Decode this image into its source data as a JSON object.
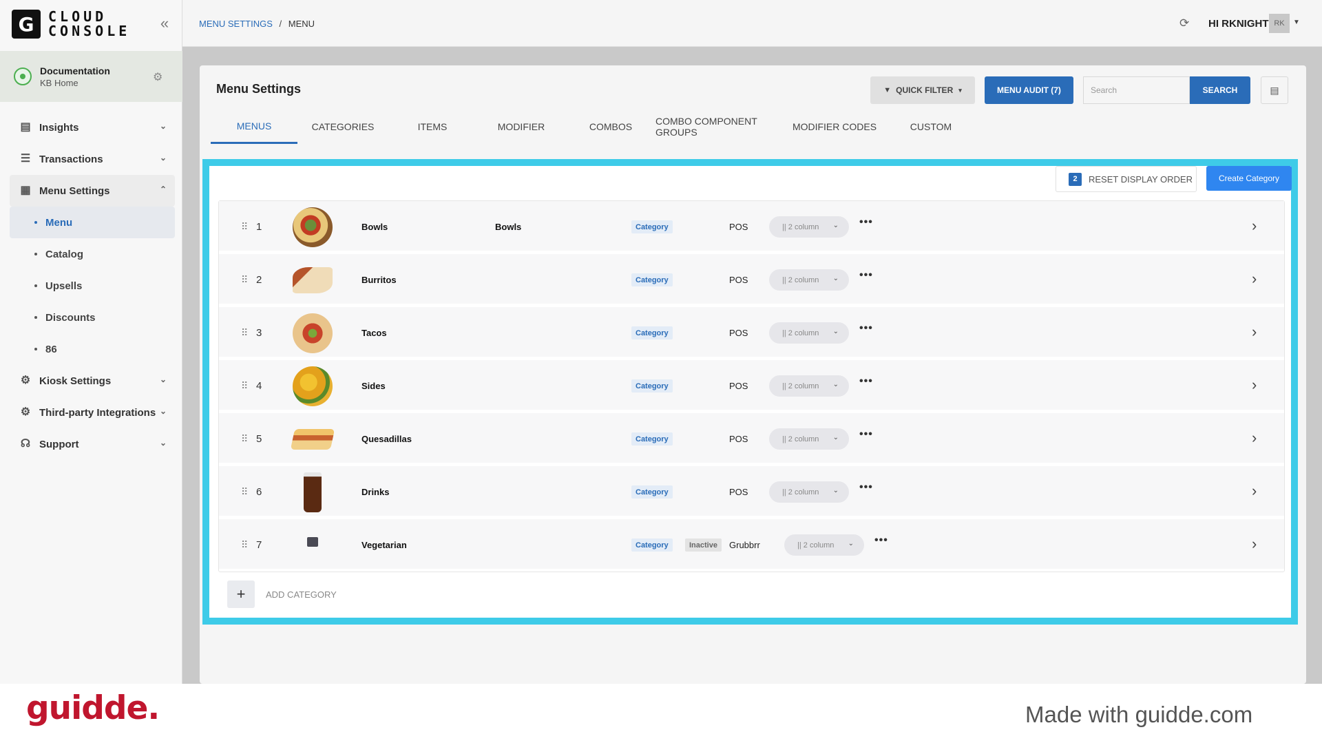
{
  "sidebar": {
    "logo_letter": "G",
    "logo_line1": "CLOUD",
    "logo_line2": "CONSOLE",
    "account": {
      "title": "Documentation",
      "subtitle": "KB Home"
    },
    "items": [
      {
        "label": "Insights"
      },
      {
        "label": "Transactions"
      },
      {
        "label": "Menu Settings"
      },
      {
        "label": "Kiosk Settings"
      },
      {
        "label": "Third-party Integrations"
      },
      {
        "label": "Support"
      }
    ],
    "subitems": [
      {
        "label": "Menu"
      },
      {
        "label": "Catalog"
      },
      {
        "label": "Upsells"
      },
      {
        "label": "Discounts"
      },
      {
        "label": "86"
      }
    ]
  },
  "header": {
    "breadcrumb_parent": "MENU SETTINGS",
    "breadcrumb_sep": "/",
    "breadcrumb_current": "MENU",
    "greeting": "HI RKNIGHT",
    "avatar_initials": "RK"
  },
  "main": {
    "title": "Menu Settings",
    "quick_filter": "QUICK FILTER",
    "menu_audit": "MENU AUDIT (7)",
    "search_placeholder": "Search",
    "search_button": "SEARCH",
    "tabs": [
      {
        "label": "MENUS"
      },
      {
        "label": "CATEGORIES"
      },
      {
        "label": "ITEMS"
      },
      {
        "label": "MODIFIER"
      },
      {
        "label": "COMBOS"
      },
      {
        "label": "COMBO COMPONENT GROUPS"
      },
      {
        "label": "MODIFIER CODES"
      },
      {
        "label": "CUSTOM"
      }
    ]
  },
  "panel": {
    "reset_badge": "2",
    "reset_label": "RESET DISPLAY ORDER",
    "create_label": "Create Category",
    "add_label": "ADD CATEGORY",
    "rows": [
      {
        "num": "1",
        "name": "Bowls",
        "desc": "Bowls",
        "chip": "Category",
        "status": "",
        "source": "POS",
        "layout": "|| 2 column"
      },
      {
        "num": "2",
        "name": "Burritos",
        "desc": "",
        "chip": "Category",
        "status": "",
        "source": "POS",
        "layout": "|| 2 column"
      },
      {
        "num": "3",
        "name": "Tacos",
        "desc": "",
        "chip": "Category",
        "status": "",
        "source": "POS",
        "layout": "|| 2 column"
      },
      {
        "num": "4",
        "name": "Sides",
        "desc": "",
        "chip": "Category",
        "status": "",
        "source": "POS",
        "layout": "|| 2 column"
      },
      {
        "num": "5",
        "name": "Quesadillas",
        "desc": "",
        "chip": "Category",
        "status": "",
        "source": "POS",
        "layout": "|| 2 column"
      },
      {
        "num": "6",
        "name": "Drinks",
        "desc": "",
        "chip": "Category",
        "status": "",
        "source": "POS",
        "layout": "|| 2 column"
      },
      {
        "num": "7",
        "name": "Vegetarian",
        "desc": "",
        "chip": "Category",
        "status": "Inactive",
        "source": "Grubbrr",
        "layout": "|| 2 column"
      }
    ]
  },
  "footer": {
    "brand": "guidde.",
    "made_with": "Made with guidde.com"
  },
  "colors": {
    "accent": "#2a6cb8",
    "highlight": "#3ecbe8",
    "brand_red": "#c0162e"
  }
}
